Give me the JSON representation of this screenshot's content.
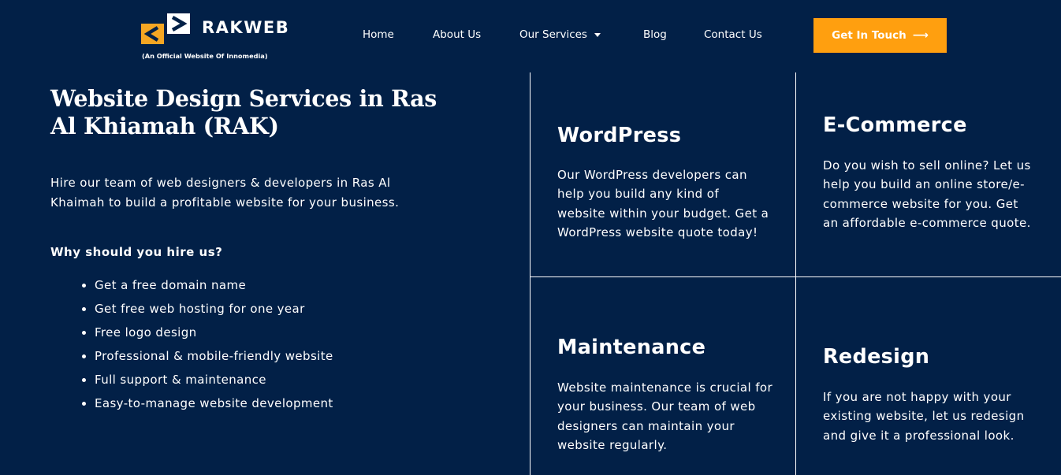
{
  "brand": {
    "name": "RAKWEB",
    "tagline": "(An Official Website Of Innomedia)",
    "colors": {
      "background": "#022047",
      "accent": "#ff9f0f",
      "logo_orange": "#f5a623"
    }
  },
  "nav": {
    "items": [
      "Home",
      "About Us",
      "Our Services",
      "Blog",
      "Contact Us"
    ],
    "cta_label": "Get In Touch",
    "cta_icon": "arrow-right-icon"
  },
  "hero": {
    "title": "Website Design Services in Ras Al Khiamah (RAK)",
    "description": "Hire our team of web designers & developers in Ras Al Khaimah to build a profitable website for your business.",
    "why_heading": "Why should you hire us?",
    "benefits": [
      "Get a free domain name",
      "Get free web hosting for one year",
      "Free logo design",
      "Professional & mobile-friendly website",
      "Full support & maintenance",
      "Easy-to-manage website development"
    ]
  },
  "services": [
    {
      "title": "WordPress",
      "description": "Our WordPress developers can help you build any kind of website within your budget. Get a WordPress website quote today!"
    },
    {
      "title": "E-Commerce",
      "description": "Do you wish to sell online? Let us help you build an online store/e-commerce website for you. Get an affordable e-commerce quote."
    },
    {
      "title": "Maintenance",
      "description": "Website maintenance is crucial for your business. Our team of web designers can maintain your website regularly."
    },
    {
      "title": "Redesign",
      "description": "If you are not happy with your existing website, let us redesign and give it a professional look."
    }
  ]
}
